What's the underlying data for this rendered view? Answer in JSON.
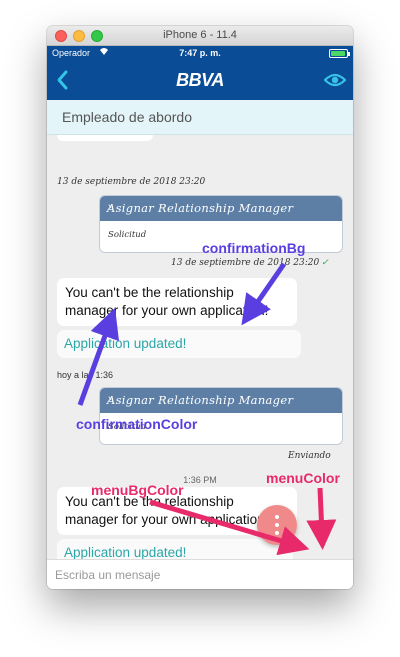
{
  "window": {
    "title": "iPhone 6 - 11.4"
  },
  "statusbar": {
    "carrier": "Operador",
    "time": "7:47 p. m."
  },
  "navbar": {
    "logo": "BBVA"
  },
  "subheader": {
    "title": "Empleado de abordo"
  },
  "messages": {
    "ts1": "13 de septiembre de 2018 23:20",
    "card1": {
      "title": "Asignar Relationship Manager",
      "body": "Solicitud"
    },
    "ts2": "13 de septiembre de 2018 23:20",
    "msg1": "You can't be the relationship manager for your own application!",
    "conf1": "Application updated!",
    "ts3": "hoy a las 1:36",
    "card2": {
      "title": "Asignar Relationship Manager",
      "body": "Solicitud"
    },
    "sending": "Enviando",
    "time_pill": "1:36 PM",
    "msg2": "You can't be the relationship manager for your own application!",
    "conf2": "Application updated!"
  },
  "input": {
    "placeholder": "Escriba un mensaje",
    "value": ""
  },
  "annotations": {
    "confirmationBg": "confirmationBg",
    "confirmationColor": "confirmationColor",
    "menuColor": "menuColor",
    "menuBgColor": "menuBgColor"
  },
  "colors": {
    "brand_blue": "#0a4c95",
    "card_header": "#5d7fa6",
    "confirmation_text": "#2aa6a8",
    "fab_bg": "#f08a8a",
    "annotation_purple": "#5a3ee0",
    "annotation_pink": "#e82a6a"
  },
  "icons": [
    "back-icon",
    "eye-icon",
    "wifi-icon",
    "battery-icon",
    "chevron-right-icon",
    "check-icon",
    "more-vertical-icon"
  ]
}
